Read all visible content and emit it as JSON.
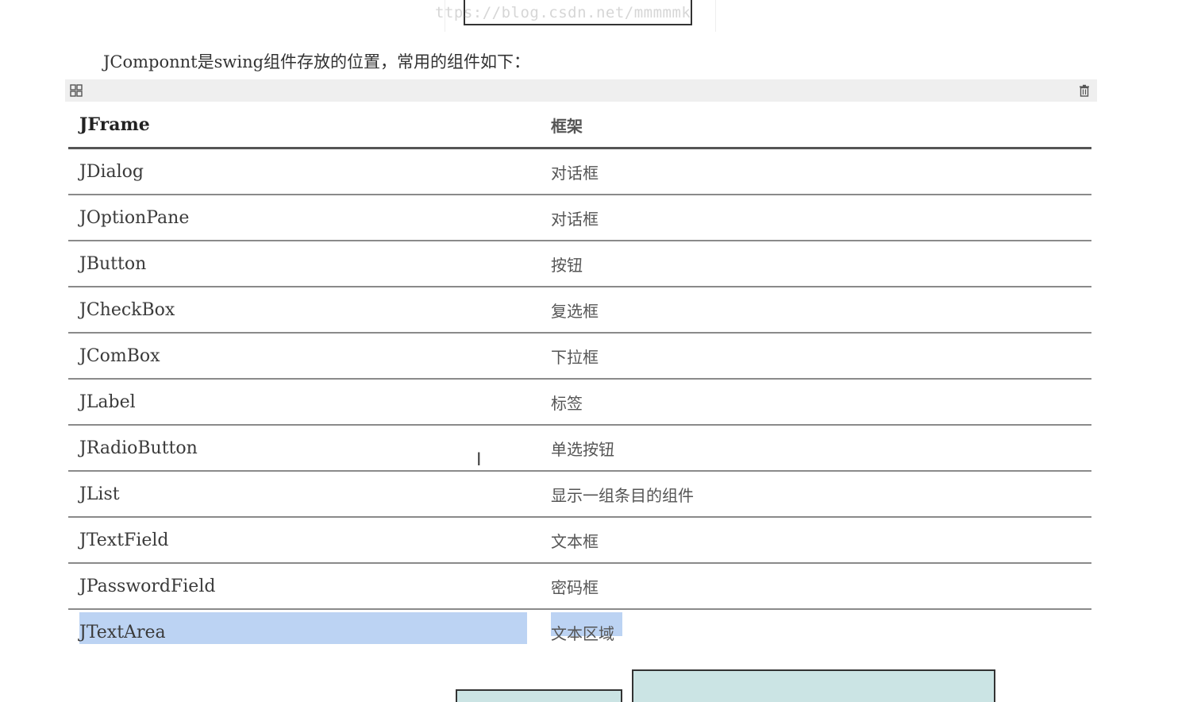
{
  "watermark": "ttps://blog.csdn.net/mmmmmk",
  "intro_text": "JComponnt是swing组件存放的位置，常用的组件如下：",
  "toolbar": {
    "left_icon": "grid-icon",
    "right_icon": "trash-icon"
  },
  "table": {
    "header": {
      "name": "JFrame",
      "desc": "框架"
    },
    "rows": [
      {
        "name": "JDialog",
        "desc": "对话框"
      },
      {
        "name": "JOptionPane",
        "desc": "对话框"
      },
      {
        "name": "JButton",
        "desc": "按钮"
      },
      {
        "name": "JCheckBox",
        "desc": "复选框"
      },
      {
        "name": "JComBox",
        "desc": "下拉框"
      },
      {
        "name": "JLabel",
        "desc": "标签"
      },
      {
        "name": "JRadioButton",
        "desc": "单选按钮"
      },
      {
        "name": "JList",
        "desc": "显示一组条目的组件"
      },
      {
        "name": "JTextField",
        "desc": "文本框"
      },
      {
        "name": "JPasswordField",
        "desc": "密码框"
      },
      {
        "name": "JTextArea",
        "desc": "文本区域"
      }
    ]
  },
  "colors": {
    "selection": "#bcd3f3",
    "toolbar_bg": "#efefef",
    "diagram_fill": "#cbe4e4"
  },
  "cursor_glyph": "I"
}
